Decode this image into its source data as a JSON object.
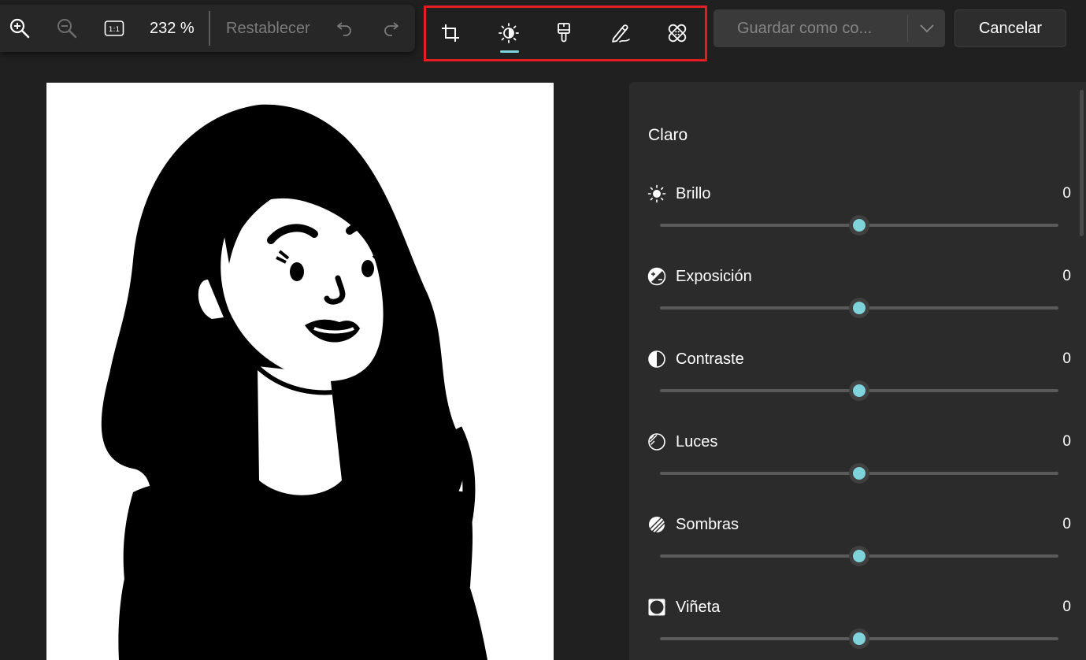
{
  "toolbar": {
    "zoom_level": "232 %",
    "reset_label": "Restablecer"
  },
  "tools": [
    {
      "name": "crop-tool",
      "icon": "crop-icon"
    },
    {
      "name": "adjust-tool",
      "icon": "brightness-icon",
      "active": true
    },
    {
      "name": "filter-tool",
      "icon": "brush-icon"
    },
    {
      "name": "markup-tool",
      "icon": "pen-icon"
    },
    {
      "name": "retouch-tool",
      "icon": "bandage-icon"
    }
  ],
  "actions": {
    "save_label": "Guardar como co...",
    "cancel_label": "Cancelar"
  },
  "panel": {
    "section_title": "Claro",
    "adjustments": [
      {
        "id": "brillo",
        "icon": "brightness-icon",
        "label": "Brillo",
        "value": "0",
        "position": 0.5
      },
      {
        "id": "exposicion",
        "icon": "exposure-icon",
        "label": "Exposición",
        "value": "0",
        "position": 0.5
      },
      {
        "id": "contraste",
        "icon": "contrast-icon",
        "label": "Contraste",
        "value": "0",
        "position": 0.5
      },
      {
        "id": "luces",
        "icon": "highlights-icon",
        "label": "Luces",
        "value": "0",
        "position": 0.5
      },
      {
        "id": "sombras",
        "icon": "shadows-icon",
        "label": "Sombras",
        "value": "0",
        "position": 0.5
      },
      {
        "id": "vineta",
        "icon": "vignette-icon",
        "label": "Viñeta",
        "value": "0",
        "position": 0.5
      }
    ]
  },
  "colors": {
    "accent": "#7fd4dc",
    "highlight_border": "#e51d24"
  }
}
